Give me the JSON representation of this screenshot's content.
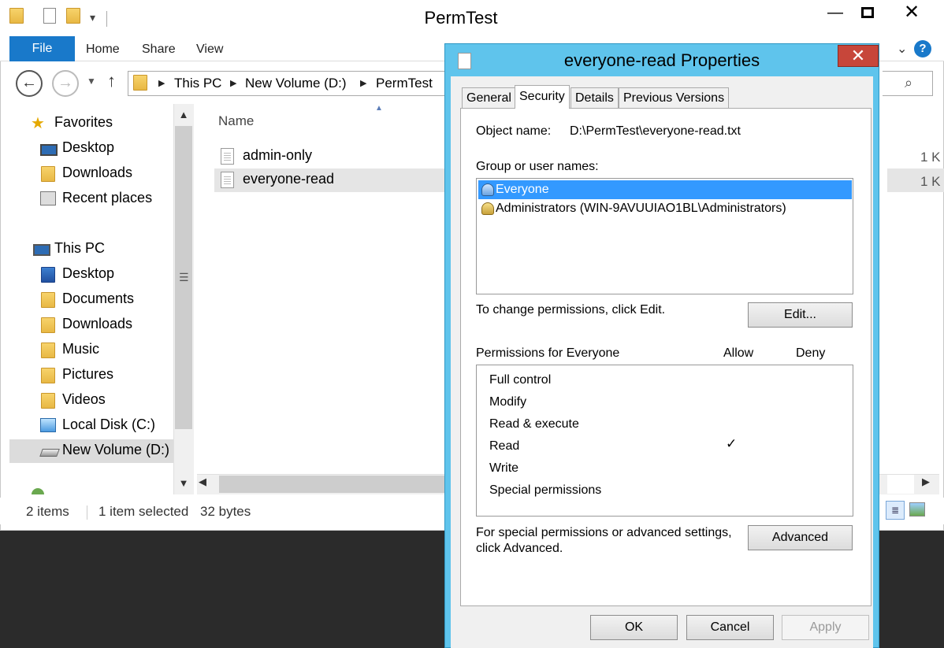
{
  "explorer": {
    "title": "PermTest",
    "window_buttons": {
      "minimize": "—",
      "maximize": "□",
      "close": "✕"
    },
    "ribbon": {
      "tabs": [
        "File",
        "Home",
        "Share",
        "View"
      ],
      "expand_glyph": "⌄",
      "help_glyph": "?"
    },
    "address": {
      "segments": [
        "This PC",
        "New Volume (D:)",
        "PermTest"
      ],
      "separator": "▶"
    },
    "nav": {
      "items": [
        {
          "label": "Favorites",
          "icon": "star-icon"
        },
        {
          "label": "Desktop",
          "icon": "desktop-icon"
        },
        {
          "label": "Downloads",
          "icon": "folder-icon"
        },
        {
          "label": "Recent places",
          "icon": "recent-places-icon"
        },
        {
          "label": "This PC",
          "icon": "computer-icon"
        },
        {
          "label": "Desktop",
          "icon": "folder-icon"
        },
        {
          "label": "Documents",
          "icon": "folder-icon"
        },
        {
          "label": "Downloads",
          "icon": "folder-icon"
        },
        {
          "label": "Music",
          "icon": "folder-icon"
        },
        {
          "label": "Pictures",
          "icon": "folder-icon"
        },
        {
          "label": "Videos",
          "icon": "folder-icon"
        },
        {
          "label": "Local Disk (C:)",
          "icon": "windows-drive-icon"
        },
        {
          "label": "New Volume (D:)",
          "icon": "drive-icon",
          "selected": true
        }
      ]
    },
    "columns": {
      "name": "Name"
    },
    "files": [
      {
        "name": "admin-only",
        "size": "1 K"
      },
      {
        "name": "everyone-read",
        "size": "1 K",
        "selected": true
      }
    ],
    "status": {
      "items_count": "2 items",
      "selected": "1 item selected",
      "size": "32 bytes"
    }
  },
  "dialog": {
    "title": "everyone-read Properties",
    "close_glyph": "✕",
    "tabs": [
      "General",
      "Security",
      "Details",
      "Previous Versions"
    ],
    "active_tab": "Security",
    "object_name_label": "Object name:",
    "object_name_value": "D:\\PermTest\\everyone-read.txt",
    "group_label": "Group or user names:",
    "users": [
      {
        "name": "Everyone",
        "selected": true
      },
      {
        "name": "Administrators (WIN-9AVUUIAO1BL\\Administrators)"
      }
    ],
    "change_hint": "To change permissions, click Edit.",
    "edit_button": "Edit...",
    "permissions_label": "Permissions for Everyone",
    "allow_header": "Allow",
    "deny_header": "Deny",
    "permissions": [
      {
        "name": "Full control",
        "allow": "",
        "deny": ""
      },
      {
        "name": "Modify",
        "allow": "",
        "deny": ""
      },
      {
        "name": "Read & execute",
        "allow": "",
        "deny": ""
      },
      {
        "name": "Read",
        "allow": "✓",
        "deny": ""
      },
      {
        "name": "Write",
        "allow": "",
        "deny": ""
      },
      {
        "name": "Special permissions",
        "allow": "",
        "deny": ""
      }
    ],
    "advanced_hint_line1": "For special permissions or advanced settings,",
    "advanced_hint_line2": "click Advanced.",
    "advanced_button": "Advanced",
    "ok_button": "OK",
    "cancel_button": "Cancel",
    "apply_button": "Apply"
  },
  "colors": {
    "ribbon_file_tab": "#1979ca",
    "dialog_frame": "#5fc4ec",
    "dialog_close": "#c7463a",
    "selection": "#3399ff"
  }
}
